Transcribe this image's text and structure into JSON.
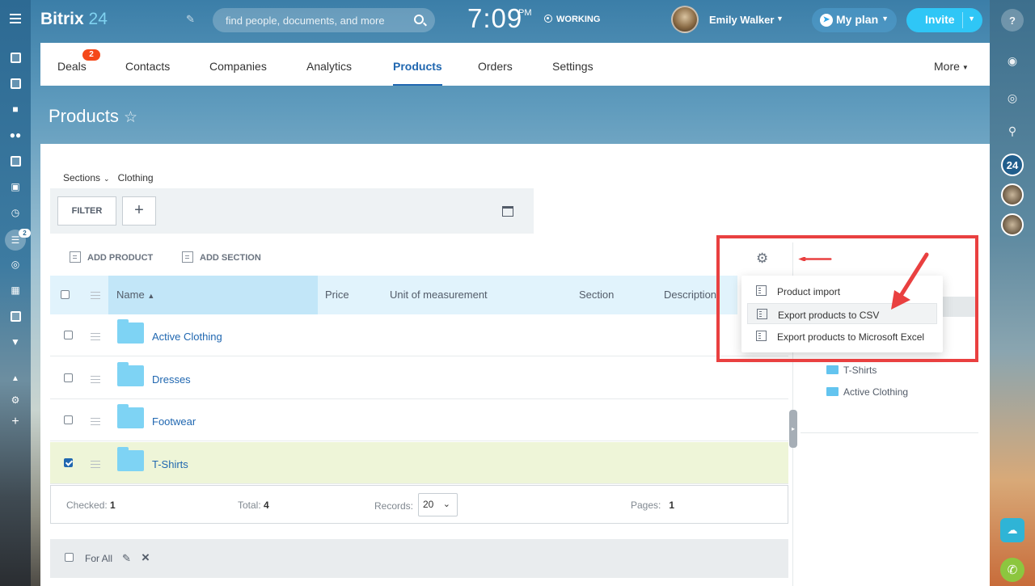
{
  "app": {
    "logo_name": "Bitrix",
    "logo_num": "24",
    "search_placeholder": "find people, documents, and more",
    "clock": "7:09",
    "clock_suffix": "PM",
    "working_status": "WORKING",
    "user_name": "Emily Walker",
    "myplan_label": "My plan",
    "invite_label": "Invite"
  },
  "left_rail": {
    "badge": "2",
    "icons": [
      "feed-icon",
      "tasks-icon",
      "chat-icon",
      "groups-icon",
      "contact-card-icon",
      "cart-icon",
      "time-icon",
      "crm-filter-icon",
      "target-icon",
      "apps-icon",
      "calendar-icon",
      "more-circle-icon",
      "sitemap-icon",
      "settings-icon",
      "add-icon"
    ]
  },
  "right_rail": {
    "help": "?",
    "badge_24": "24"
  },
  "crm_nav": {
    "tabs": [
      {
        "label": "Deals",
        "badge": "2"
      },
      {
        "label": "Contacts"
      },
      {
        "label": "Companies"
      },
      {
        "label": "Analytics"
      },
      {
        "label": "Products",
        "active": true
      },
      {
        "label": "Orders"
      },
      {
        "label": "Settings"
      }
    ],
    "more": "More"
  },
  "page": {
    "title": "Products",
    "breadcrumb_sections": "Sections",
    "breadcrumb_current": "Clothing"
  },
  "toolbar": {
    "filter_label": "FILTER",
    "plus_label": "+",
    "add_product": "ADD PRODUCT",
    "add_section": "ADD SECTION"
  },
  "grid": {
    "columns": [
      "Name",
      "Price",
      "Unit of measurement",
      "Section",
      "Description"
    ],
    "rows": [
      {
        "name": "Active Clothing",
        "checked": false
      },
      {
        "name": "Dresses",
        "checked": false
      },
      {
        "name": "Footwear",
        "checked": false
      },
      {
        "name": "T-Shirts",
        "checked": true
      }
    ],
    "footer": {
      "checked_label": "Checked:",
      "checked_value": "1",
      "total_label": "Total:",
      "total_value": "4",
      "records_label": "Records:",
      "records_value": "20",
      "pages_label": "Pages:",
      "pages_value": "1"
    },
    "for_all": "For All"
  },
  "sections_tree": {
    "items": [
      "T-Shirts",
      "Active Clothing"
    ]
  },
  "settings_menu": {
    "items": [
      "Product import",
      "Export products to CSV",
      "Export products to Microsoft Excel"
    ]
  },
  "colors": {
    "accent": "#2067b0",
    "invite": "#2fc6f6",
    "annotation": "#e94040",
    "badge": "#f54819"
  }
}
